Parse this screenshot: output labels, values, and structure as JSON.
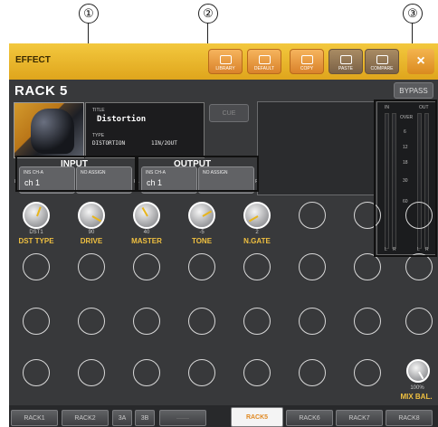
{
  "callouts": [
    "①",
    "②",
    "③"
  ],
  "window": {
    "title": "EFFECT",
    "close": "×"
  },
  "toolbar": {
    "library": "LIBRARY",
    "default": "DEFAULT",
    "copy": "COPY",
    "paste": "PASTE",
    "compare": "COMPARE"
  },
  "rack": {
    "name": "RACK 5",
    "bypass": "BYPASS"
  },
  "effect": {
    "title_label": "TITLE",
    "title": "Distortion",
    "type_label": "TYPE",
    "type": "DISTORTION",
    "io_config": "1IN/2OUT",
    "cue": "CUE"
  },
  "input": {
    "label": "INPUT",
    "ch_hint": "INS CH-A",
    "ch_value": "ch 1",
    "na_hint": "NO ASSIGN",
    "side_l": "L",
    "side_r": "R"
  },
  "output": {
    "label": "OUTPUT",
    "ch_hint": "INS CH-A",
    "ch_value": "ch 1",
    "na_hint": "NO ASSIGN",
    "side_l": "L",
    "side_r": "R"
  },
  "meter": {
    "in": "IN",
    "out": "OUT",
    "scale": [
      "OVER",
      "6",
      "12",
      "18",
      "30",
      "60"
    ],
    "l": "L",
    "r": "R",
    "levels": {
      "in_l": 0,
      "in_r": 0,
      "out_l": 0,
      "out_r": 0
    }
  },
  "knobs": [
    {
      "name": "DST TYPE",
      "value": "DST1"
    },
    {
      "name": "DRIVE",
      "value": "90"
    },
    {
      "name": "MASTER",
      "value": "40"
    },
    {
      "name": "TONE",
      "value": "-5"
    },
    {
      "name": "N.GATE",
      "value": "2"
    }
  ],
  "mix": {
    "name": "MIX BAL.",
    "value": "100%"
  },
  "tabs": [
    "RACK1",
    "RACK2",
    "3A",
    "3B",
    "——",
    "RACK5",
    "RACK6",
    "RACK7",
    "RACK8"
  ],
  "active_tab": "RACK5",
  "colors": {
    "titlebar": "#e9b62c",
    "accent": "#f0c040",
    "panel": "#38393b"
  }
}
